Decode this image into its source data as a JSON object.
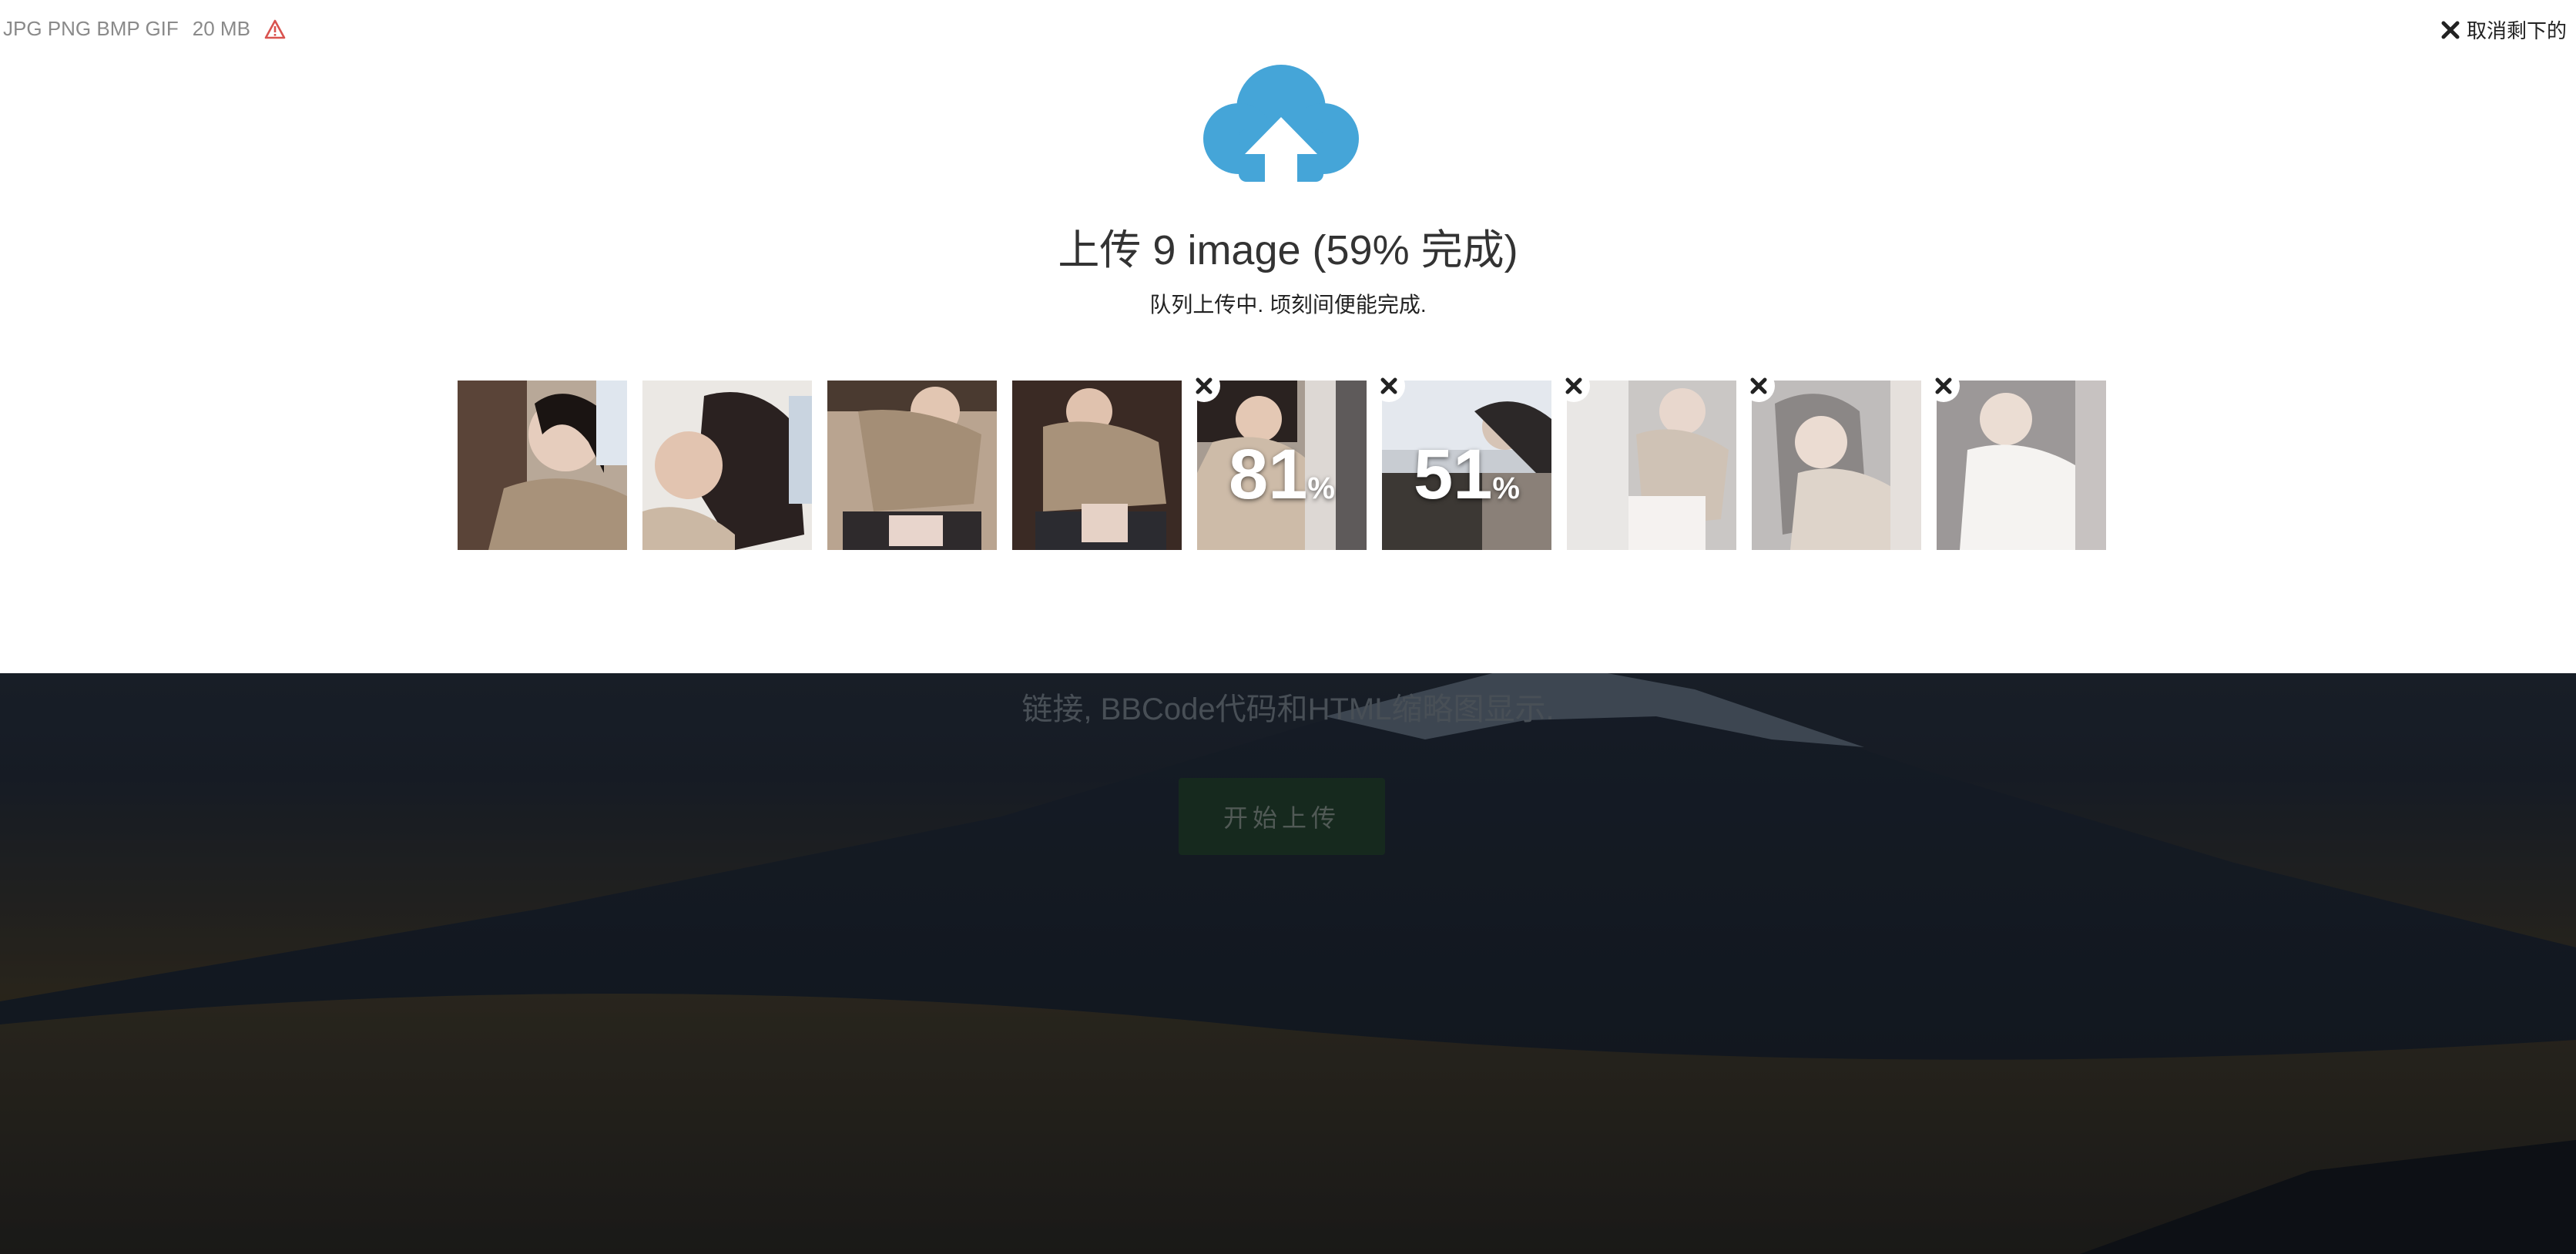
{
  "upload_panel": {
    "formats": "JPG PNG BMP GIF",
    "max_size": "20 MB",
    "warning_icon": "warning-triangle-icon",
    "cancel_label": "取消剩下的",
    "title": "上传 9 image (59% 完成)",
    "subtitle": "队列上传中. 顷刻间便能完成.",
    "colors": {
      "cloud": "#45a5d8",
      "warning": "#d9534f"
    }
  },
  "thumbnails": [
    {
      "status": "done"
    },
    {
      "status": "done"
    },
    {
      "status": "done"
    },
    {
      "status": "done"
    },
    {
      "status": "uploading",
      "progress": "81",
      "unit": "%"
    },
    {
      "status": "uploading",
      "progress": "51",
      "unit": "%"
    },
    {
      "status": "queued"
    },
    {
      "status": "queued"
    },
    {
      "status": "queued"
    }
  ],
  "background": {
    "description_line": "链接, BBCode代码和HTML缩略图显示.",
    "start_button": "开始上传"
  }
}
